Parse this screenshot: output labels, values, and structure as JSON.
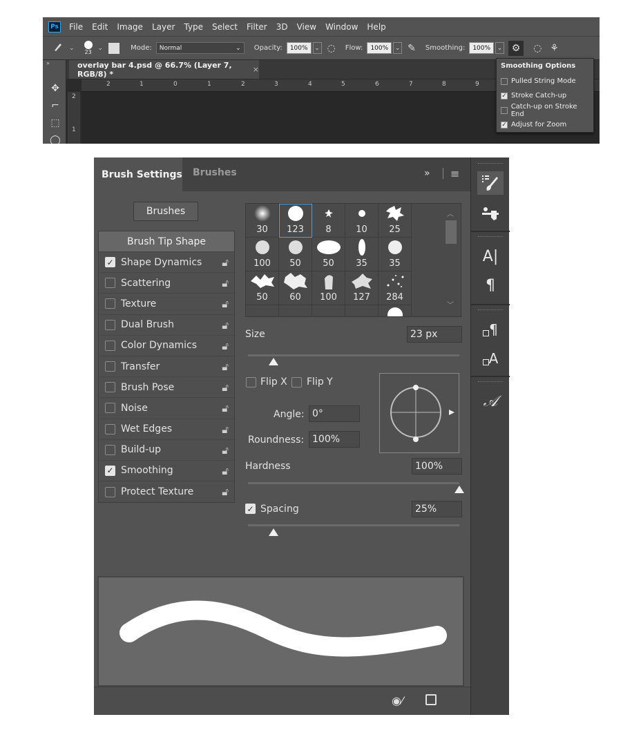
{
  "app": {
    "logo": "Ps",
    "menu": [
      "File",
      "Edit",
      "Image",
      "Layer",
      "Type",
      "Select",
      "Filter",
      "3D",
      "View",
      "Window",
      "Help"
    ]
  },
  "options_bar": {
    "brush_size": "23",
    "mode_label": "Mode:",
    "mode_value": "Normal",
    "opacity_label": "Opacity:",
    "opacity_value": "100%",
    "flow_label": "Flow:",
    "flow_value": "100%",
    "smoothing_label": "Smoothing:",
    "smoothing_value": "100%"
  },
  "document_tab": {
    "title": "overlay bar 4.psd @ 66.7% (Layer 7, RGB/8) *",
    "close": "×"
  },
  "rulers": {
    "top": [
      "2",
      "1",
      "0",
      "1",
      "2",
      "3",
      "4",
      "5",
      "6",
      "7",
      "8",
      "9"
    ],
    "left": [
      "2",
      "1"
    ]
  },
  "smoothing_popup": {
    "title": "Smoothing Options",
    "options": [
      {
        "label": "Pulled String Mode",
        "checked": false
      },
      {
        "label": "Stroke Catch-up",
        "checked": true
      },
      {
        "label": "Catch-up on Stroke End",
        "checked": false
      },
      {
        "label": "Adjust for Zoom",
        "checked": true
      }
    ]
  },
  "panel": {
    "tab_active": "Brush Settings",
    "tab_inactive": "Brushes",
    "collapse_glyph": "»",
    "brushes_button": "Brushes",
    "tip_shape_label": "Brush Tip Shape",
    "options": [
      {
        "label": "Shape Dynamics",
        "checked": true
      },
      {
        "label": "Scattering",
        "checked": false
      },
      {
        "label": "Texture",
        "checked": false
      },
      {
        "label": "Dual Brush",
        "checked": false
      },
      {
        "label": "Color Dynamics",
        "checked": false
      },
      {
        "label": "Transfer",
        "checked": false
      },
      {
        "label": "Brush Pose",
        "checked": false
      },
      {
        "label": "Noise",
        "checked": false
      },
      {
        "label": "Wet Edges",
        "checked": false
      },
      {
        "label": "Build-up",
        "checked": false
      },
      {
        "label": "Smoothing",
        "checked": true
      },
      {
        "label": "Protect Texture",
        "checked": false
      }
    ],
    "tips": [
      "30",
      "123",
      "8",
      "10",
      "25",
      "100",
      "50",
      "50",
      "35",
      "35",
      "50",
      "60",
      "100",
      "127",
      "284"
    ],
    "size_label": "Size",
    "size_value": "23 px",
    "flip_x": "Flip X",
    "flip_y": "Flip Y",
    "angle_label": "Angle:",
    "angle_value": "0°",
    "roundness_label": "Roundness:",
    "roundness_value": "100%",
    "hardness_label": "Hardness",
    "hardness_value": "100%",
    "spacing_label": "Spacing",
    "spacing_value": "25%",
    "spacing_checked": true,
    "size_slider_pct": 0.12,
    "hardness_slider_pct": 1.0,
    "spacing_slider_pct": 0.12
  },
  "dock": {
    "type_a": "A|",
    "pilcrow": "¶",
    "char_style": "A",
    "glyph": "𝒜"
  }
}
